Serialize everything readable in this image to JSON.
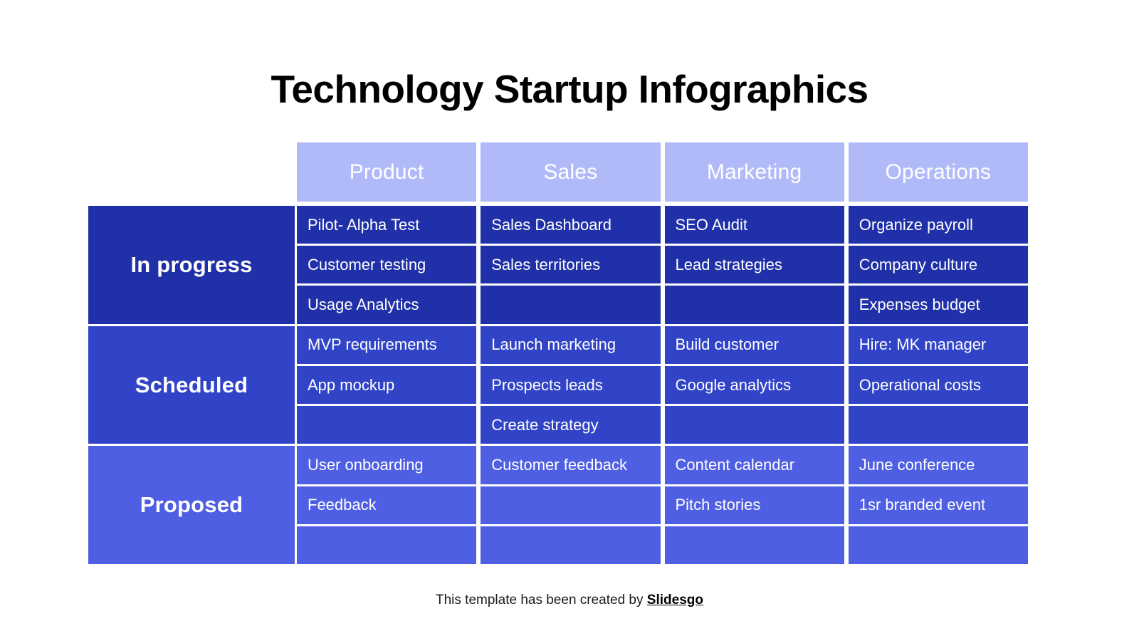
{
  "title": "Technology Startup Infographics",
  "colors": {
    "page_background": "#ffffff",
    "header_cell": "#b0baf9",
    "in_progress": "#2030a8",
    "scheduled": "#3144c8",
    "proposed": "#4f5fe3",
    "text_on_blue": "#ffffff",
    "title_text": "#000000"
  },
  "matrix": {
    "columns": [
      {
        "label": "Product"
      },
      {
        "label": "Sales"
      },
      {
        "label": "Marketing"
      },
      {
        "label": "Operations"
      }
    ],
    "rows": [
      {
        "label": "In progress",
        "color": "#2030a8",
        "cells": [
          [
            "Pilot- Alpha Test",
            "Customer testing",
            "Usage Analytics"
          ],
          [
            "Sales Dashboard",
            "Sales territories",
            ""
          ],
          [
            "SEO Audit",
            "Lead strategies",
            ""
          ],
          [
            "Organize payroll",
            "Company culture",
            "Expenses budget"
          ]
        ]
      },
      {
        "label": "Scheduled",
        "color": "#3144c8",
        "cells": [
          [
            "MVP requirements",
            "App mockup",
            ""
          ],
          [
            "Launch marketing",
            "Prospects leads",
            "Create strategy"
          ],
          [
            "Build customer",
            "Google analytics",
            ""
          ],
          [
            "Hire: MK manager",
            "Operational costs",
            ""
          ]
        ]
      },
      {
        "label": "Proposed",
        "color": "#4f5fe3",
        "cells": [
          [
            "User onboarding",
            "Feedback",
            ""
          ],
          [
            "Customer feedback",
            "",
            ""
          ],
          [
            "Content calendar",
            "Pitch stories",
            ""
          ],
          [
            "June conference",
            "1sr branded event",
            ""
          ]
        ]
      }
    ]
  },
  "footer": {
    "text": "This template has been created by ",
    "brand": "Slidesgo"
  }
}
